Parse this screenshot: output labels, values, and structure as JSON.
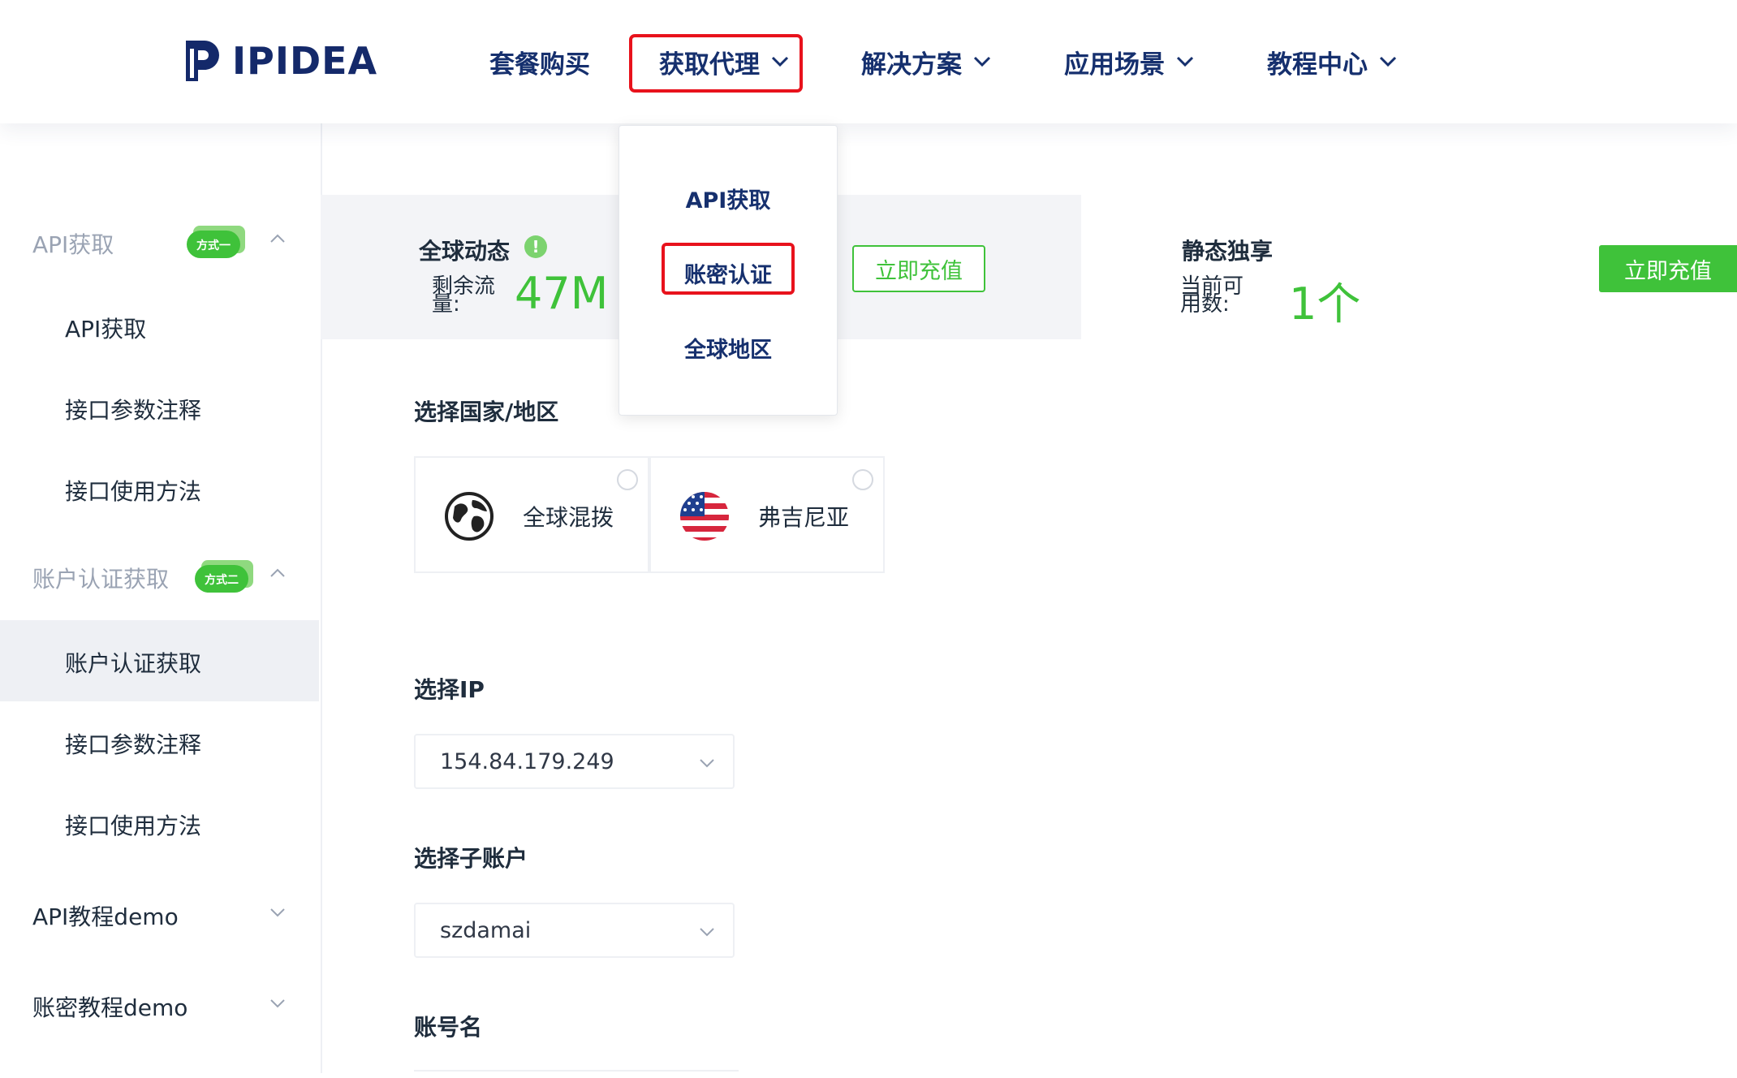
{
  "brand": {
    "name": "IPIDEA",
    "color": "#14296a"
  },
  "nav": {
    "items": [
      {
        "label": "套餐购买",
        "has_dropdown": false
      },
      {
        "label": "获取代理",
        "has_dropdown": true,
        "active": true
      },
      {
        "label": "解决方案",
        "has_dropdown": true
      },
      {
        "label": "应用场景",
        "has_dropdown": true
      },
      {
        "label": "教程中心",
        "has_dropdown": true
      }
    ],
    "dropdown": {
      "items": [
        "API获取",
        "账密认证",
        "全球地区"
      ],
      "highlighted": "账密认证"
    }
  },
  "sidebar": {
    "groups": [
      {
        "label": "API获取",
        "badge": "方式一",
        "expanded": true,
        "items": [
          "API获取",
          "接口参数注释",
          "接口使用方法"
        ]
      },
      {
        "label": "账户认证获取",
        "badge": "方式二",
        "expanded": true,
        "items": [
          "账户认证获取",
          "接口参数注释",
          "接口使用方法"
        ],
        "active_item": "账户认证获取"
      },
      {
        "label": "API教程demo",
        "expanded": false
      },
      {
        "label": "账密教程demo",
        "expanded": false
      }
    ]
  },
  "stats": {
    "dynamic": {
      "title": "全球动态",
      "info": "!",
      "label": "剩余流量:",
      "value": "47M",
      "button": "立即充值"
    },
    "static": {
      "title": "静态独享",
      "label": "当前可用数:",
      "value": "1个",
      "button": "立即充值"
    }
  },
  "form": {
    "country": {
      "title": "选择国家/地区",
      "options": [
        {
          "label": "全球混拨",
          "icon": "globe-icon"
        },
        {
          "label": "弗吉尼亚",
          "icon": "us-flag-icon"
        }
      ]
    },
    "ip": {
      "title": "选择IP",
      "value": "154.84.179.249"
    },
    "subaccount": {
      "title": "选择子账户",
      "value": "szdamai"
    },
    "account_name": {
      "title": "账号名"
    }
  },
  "colors": {
    "accent_green": "#3fc23a",
    "highlight_red": "#e8121c",
    "nav_text": "#16306e"
  }
}
